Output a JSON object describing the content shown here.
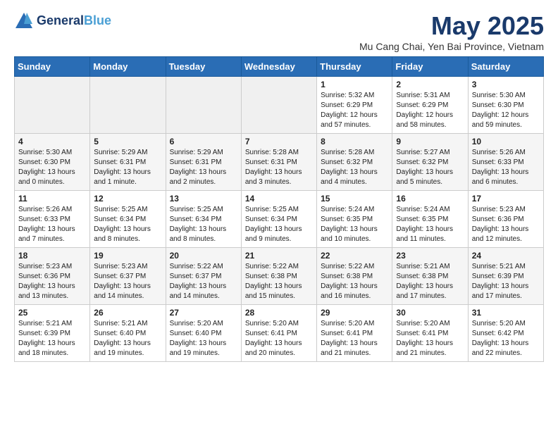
{
  "header": {
    "logo_line1": "General",
    "logo_line2": "Blue",
    "title": "May 2025",
    "subtitle": "Mu Cang Chai, Yen Bai Province, Vietnam"
  },
  "calendar": {
    "days_of_week": [
      "Sunday",
      "Monday",
      "Tuesday",
      "Wednesday",
      "Thursday",
      "Friday",
      "Saturday"
    ],
    "weeks": [
      [
        {
          "day": "",
          "info": ""
        },
        {
          "day": "",
          "info": ""
        },
        {
          "day": "",
          "info": ""
        },
        {
          "day": "",
          "info": ""
        },
        {
          "day": "1",
          "info": "Sunrise: 5:32 AM\nSunset: 6:29 PM\nDaylight: 12 hours\nand 57 minutes."
        },
        {
          "day": "2",
          "info": "Sunrise: 5:31 AM\nSunset: 6:29 PM\nDaylight: 12 hours\nand 58 minutes."
        },
        {
          "day": "3",
          "info": "Sunrise: 5:30 AM\nSunset: 6:30 PM\nDaylight: 12 hours\nand 59 minutes."
        }
      ],
      [
        {
          "day": "4",
          "info": "Sunrise: 5:30 AM\nSunset: 6:30 PM\nDaylight: 13 hours\nand 0 minutes."
        },
        {
          "day": "5",
          "info": "Sunrise: 5:29 AM\nSunset: 6:31 PM\nDaylight: 13 hours\nand 1 minute."
        },
        {
          "day": "6",
          "info": "Sunrise: 5:29 AM\nSunset: 6:31 PM\nDaylight: 13 hours\nand 2 minutes."
        },
        {
          "day": "7",
          "info": "Sunrise: 5:28 AM\nSunset: 6:31 PM\nDaylight: 13 hours\nand 3 minutes."
        },
        {
          "day": "8",
          "info": "Sunrise: 5:28 AM\nSunset: 6:32 PM\nDaylight: 13 hours\nand 4 minutes."
        },
        {
          "day": "9",
          "info": "Sunrise: 5:27 AM\nSunset: 6:32 PM\nDaylight: 13 hours\nand 5 minutes."
        },
        {
          "day": "10",
          "info": "Sunrise: 5:26 AM\nSunset: 6:33 PM\nDaylight: 13 hours\nand 6 minutes."
        }
      ],
      [
        {
          "day": "11",
          "info": "Sunrise: 5:26 AM\nSunset: 6:33 PM\nDaylight: 13 hours\nand 7 minutes."
        },
        {
          "day": "12",
          "info": "Sunrise: 5:25 AM\nSunset: 6:34 PM\nDaylight: 13 hours\nand 8 minutes."
        },
        {
          "day": "13",
          "info": "Sunrise: 5:25 AM\nSunset: 6:34 PM\nDaylight: 13 hours\nand 8 minutes."
        },
        {
          "day": "14",
          "info": "Sunrise: 5:25 AM\nSunset: 6:34 PM\nDaylight: 13 hours\nand 9 minutes."
        },
        {
          "day": "15",
          "info": "Sunrise: 5:24 AM\nSunset: 6:35 PM\nDaylight: 13 hours\nand 10 minutes."
        },
        {
          "day": "16",
          "info": "Sunrise: 5:24 AM\nSunset: 6:35 PM\nDaylight: 13 hours\nand 11 minutes."
        },
        {
          "day": "17",
          "info": "Sunrise: 5:23 AM\nSunset: 6:36 PM\nDaylight: 13 hours\nand 12 minutes."
        }
      ],
      [
        {
          "day": "18",
          "info": "Sunrise: 5:23 AM\nSunset: 6:36 PM\nDaylight: 13 hours\nand 13 minutes."
        },
        {
          "day": "19",
          "info": "Sunrise: 5:23 AM\nSunset: 6:37 PM\nDaylight: 13 hours\nand 14 minutes."
        },
        {
          "day": "20",
          "info": "Sunrise: 5:22 AM\nSunset: 6:37 PM\nDaylight: 13 hours\nand 14 minutes."
        },
        {
          "day": "21",
          "info": "Sunrise: 5:22 AM\nSunset: 6:38 PM\nDaylight: 13 hours\nand 15 minutes."
        },
        {
          "day": "22",
          "info": "Sunrise: 5:22 AM\nSunset: 6:38 PM\nDaylight: 13 hours\nand 16 minutes."
        },
        {
          "day": "23",
          "info": "Sunrise: 5:21 AM\nSunset: 6:38 PM\nDaylight: 13 hours\nand 17 minutes."
        },
        {
          "day": "24",
          "info": "Sunrise: 5:21 AM\nSunset: 6:39 PM\nDaylight: 13 hours\nand 17 minutes."
        }
      ],
      [
        {
          "day": "25",
          "info": "Sunrise: 5:21 AM\nSunset: 6:39 PM\nDaylight: 13 hours\nand 18 minutes."
        },
        {
          "day": "26",
          "info": "Sunrise: 5:21 AM\nSunset: 6:40 PM\nDaylight: 13 hours\nand 19 minutes."
        },
        {
          "day": "27",
          "info": "Sunrise: 5:20 AM\nSunset: 6:40 PM\nDaylight: 13 hours\nand 19 minutes."
        },
        {
          "day": "28",
          "info": "Sunrise: 5:20 AM\nSunset: 6:41 PM\nDaylight: 13 hours\nand 20 minutes."
        },
        {
          "day": "29",
          "info": "Sunrise: 5:20 AM\nSunset: 6:41 PM\nDaylight: 13 hours\nand 21 minutes."
        },
        {
          "day": "30",
          "info": "Sunrise: 5:20 AM\nSunset: 6:41 PM\nDaylight: 13 hours\nand 21 minutes."
        },
        {
          "day": "31",
          "info": "Sunrise: 5:20 AM\nSunset: 6:42 PM\nDaylight: 13 hours\nand 22 minutes."
        }
      ]
    ]
  }
}
